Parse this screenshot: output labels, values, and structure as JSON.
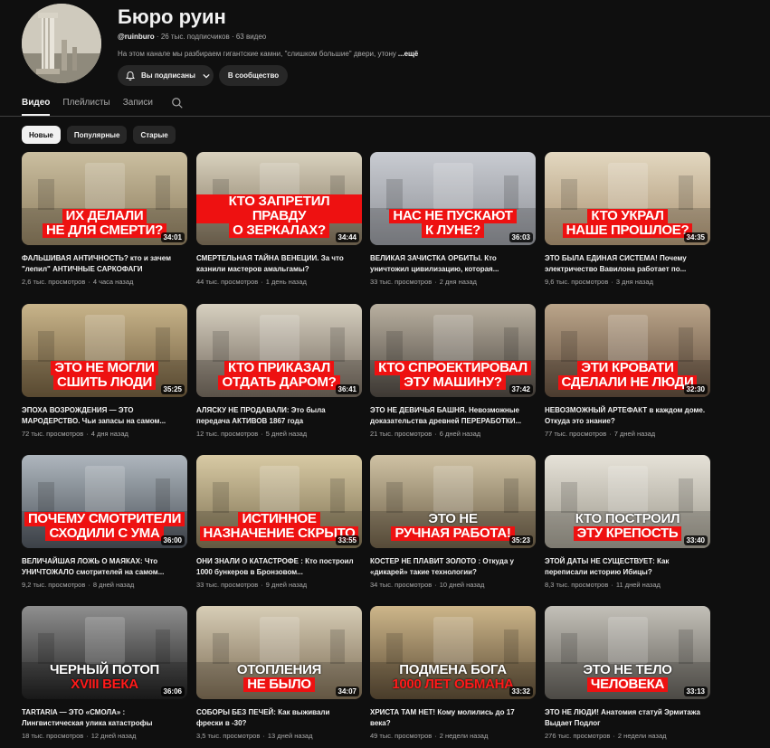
{
  "channel": {
    "title": "Бюро руин",
    "handle": "@ruinburo",
    "subscribers": "26 тыс. подписчиков",
    "video_count": "63 видео",
    "description": "На этом канале мы разбираем гигантские камни, \"слишком большие\" двери, утону",
    "more_label": "...ещё",
    "subscribed_label": "Вы подписаны",
    "community_label": "В сообщество"
  },
  "tabs": [
    {
      "label": "Видео",
      "active": true
    },
    {
      "label": "Плейлисты",
      "active": false
    },
    {
      "label": "Записи",
      "active": false
    }
  ],
  "chips": [
    {
      "label": "Новые",
      "active": true
    },
    {
      "label": "Популярные",
      "active": false
    },
    {
      "label": "Старые",
      "active": false
    }
  ],
  "videos": [
    {
      "title": "ФАЛЬШИВАЯ АНТИЧНОСТЬ? кто и зачем \"лепил\" АНТИЧНЫЕ САРКОФАГИ",
      "views": "2,6 тыс. просмотров",
      "age": "4 часа назад",
      "duration": "34:01",
      "overlay": [
        "ИХ ДЕЛАЛИ",
        "НЕ ДЛЯ СМЕРТИ?"
      ],
      "overlay_style": "red",
      "colors": [
        "#cbbfa0",
        "#8a7a5c"
      ]
    },
    {
      "title": "СМЕРТЕЛЬНАЯ ТАЙНА ВЕНЕЦИИ. За что казнили мастеров амальгамы?",
      "views": "44 тыс. просмотров",
      "age": "1 день назад",
      "duration": "34:44",
      "overlay": [
        "КТО ЗАПРЕТИЛ ПРАВДУ",
        "О ЗЕРКАЛАХ?"
      ],
      "overlay_style": "red",
      "colors": [
        "#d9d2bf",
        "#7c6e58"
      ]
    },
    {
      "title": "ВЕЛИКАЯ ЗАЧИСТКА ОРБИТЫ. Кто уничтожил цивилизацию, которая...",
      "views": "33 тыс. просмотров",
      "age": "2 дня назад",
      "duration": "36:03",
      "overlay": [
        "НАС НЕ ПУСКАЮТ",
        "К ЛУНЕ?"
      ],
      "overlay_style": "red",
      "colors": [
        "#c9ccd2",
        "#8d8f95"
      ]
    },
    {
      "title": "ЭТО БЫЛА ЕДИНАЯ СИСТЕМА! Почему электричество Вавилона работает по...",
      "views": "9,6 тыс. просмотров",
      "age": "3 дня назад",
      "duration": "34:35",
      "overlay": [
        "КТО УКРАЛ",
        "НАШЕ ПРОШЛОЕ?"
      ],
      "overlay_style": "red",
      "colors": [
        "#e3d8c0",
        "#a89070"
      ]
    },
    {
      "title": "ЭПОХА ВОЗРОЖДЕНИЯ — ЭТО МАРОДЕРСТВО. Чьи запасы на самом...",
      "views": "72 тыс. просмотров",
      "age": "4 дня назад",
      "duration": "35:25",
      "overlay": [
        "ЭТО НЕ МОГЛИ",
        "СШИТЬ ЛЮДИ"
      ],
      "overlay_style": "red",
      "colors": [
        "#c8b48a",
        "#6d5a3c"
      ]
    },
    {
      "title": "АЛЯСКУ НЕ ПРОДАВАЛИ: Это была передача АКТИВОВ 1867 года",
      "views": "12 тыс. просмотров",
      "age": "5 дней назад",
      "duration": "36:41",
      "overlay": [
        "КТО ПРИКАЗАЛ",
        "ОТДАТЬ ДАРОМ?"
      ],
      "overlay_style": "red",
      "colors": [
        "#d7d0c0",
        "#6f655a"
      ]
    },
    {
      "title": "ЭТО НЕ ДЕВИЧЬЯ БАШНЯ. Невозможные доказательства древней ПЕРЕРАБОТКИ...",
      "views": "21 тыс. просмотров",
      "age": "6 дней назад",
      "duration": "37:42",
      "overlay": [
        "КТО СПРОЕКТИРОВАЛ",
        "ЭТУ МАШИНУ?"
      ],
      "overlay_style": "red",
      "colors": [
        "#b9b0a0",
        "#4c4640"
      ]
    },
    {
      "title": "НЕВОЗМОЖНЫЙ АРТЕФАКТ в каждом доме. Откуда это знание?",
      "views": "77 тыс. просмотров",
      "age": "7 дней назад",
      "duration": "32:30",
      "overlay": [
        "ЭТИ КРОВАТИ",
        "СДЕЛАЛИ НЕ ЛЮДИ"
      ],
      "overlay_style": "red",
      "colors": [
        "#bba58a",
        "#5d4a3a"
      ]
    },
    {
      "title": "ВЕЛИЧАЙШАЯ ЛОЖЬ О МАЯКАХ: Что УНИЧТОЖАЛО смотрителей на самом...",
      "views": "9,2 тыс. просмотров",
      "age": "8 дней назад",
      "duration": "36:00",
      "overlay": [
        "ПОЧЕМУ СМОТРИТЕЛИ",
        "СХОДИЛИ С УМА"
      ],
      "overlay_style": "red",
      "colors": [
        "#aeb6bd",
        "#4a5058"
      ]
    },
    {
      "title": "ОНИ ЗНАЛИ О КАТАСТРОФЕ : Кто построил 1000 бункеров в Бронзовом...",
      "views": "33 тыс. просмотров",
      "age": "9 дней назад",
      "duration": "33:55",
      "overlay": [
        "ИСТИННОЕ",
        "НАЗНАЧЕНИЕ СКРЫТО"
      ],
      "overlay_style": "red",
      "colors": [
        "#d8caa4",
        "#7b6e50"
      ]
    },
    {
      "title": "КОСТЕР НЕ ПЛАВИТ ЗОЛОТО : Откуда у «дикарей» такие технологии?",
      "views": "34 тыс. просмотров",
      "age": "10 дней назад",
      "duration": "35:23",
      "overlay": [
        "ЭТО НЕ",
        "РУЧНАЯ РАБОТА!"
      ],
      "overlay_style": "white-red",
      "colors": [
        "#cfc2a4",
        "#6a5c45"
      ]
    },
    {
      "title": "ЭТОЙ ДАТЫ НЕ СУЩЕСТВУЕТ: Как переписали историю Ибицы?",
      "views": "8,3 тыс. просмотров",
      "age": "11 дней назад",
      "duration": "33:40",
      "overlay": [
        "КТО ПОСТРОИЛ",
        "ЭТУ КРЕПОСТЬ"
      ],
      "overlay_style": "white-red",
      "colors": [
        "#e6e2d8",
        "#9a968a"
      ]
    },
    {
      "title": "TARTARIA — ЭТО «СМОЛА» : Лингвистическая улика катастрофы",
      "views": "18 тыс. просмотров",
      "age": "12 дней назад",
      "duration": "36:06",
      "overlay": [
        "ЧЕРНЫЙ ПОТОП",
        "XVIII ВЕКА"
      ],
      "overlay_style": "white-redtext",
      "colors": [
        "#8f8f8f",
        "#1e1e1e"
      ]
    },
    {
      "title": "СОБОРЫ БЕЗ ПЕЧЕЙ: Как выживали фрески в -30?",
      "views": "3,5 тыс. просмотров",
      "age": "13 дней назад",
      "duration": "34:07",
      "overlay": [
        "ОТОПЛЕНИЯ",
        "НЕ БЫЛО"
      ],
      "overlay_style": "white-red",
      "colors": [
        "#d7cdb6",
        "#7a6a52"
      ]
    },
    {
      "title": "ХРИСТА ТАМ НЕТ! Кому молились до 17 века?",
      "views": "49 тыс. просмотров",
      "age": "2 недели назад",
      "duration": "33:32",
      "overlay": [
        "ПОДМЕНА БОГА",
        "1000 ЛЕТ ОБМАНА"
      ],
      "overlay_style": "white-redtext",
      "colors": [
        "#cdb68a",
        "#5a4a34"
      ]
    },
    {
      "title": "ЭТО НЕ ЛЮДИ! Анатомия статуй Эрмитажа Выдает Подлог",
      "views": "276 тыс. просмотров",
      "age": "2 недели назад",
      "duration": "33:13",
      "overlay": [
        "ЭТО НЕ ТЕЛО",
        "ЧЕЛОВЕКА"
      ],
      "overlay_style": "white-red",
      "colors": [
        "#c3c0b8",
        "#5e5b55"
      ]
    }
  ]
}
